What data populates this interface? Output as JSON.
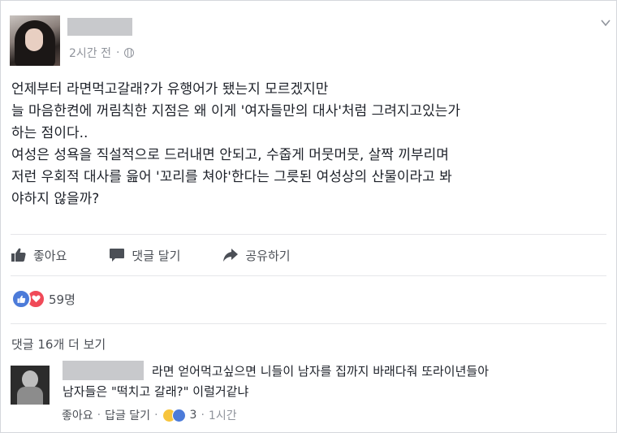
{
  "post": {
    "timestamp": "2시간 전",
    "body_lines": [
      "언제부터 라면먹고갈래?가 유행어가 됐는지 모르겠지만",
      "늘 마음한켠에 꺼림칙한 지점은 왜 이게 '여자들만의 대사'처럼 그려지고있는가",
      "하는 점이다..",
      "여성은 성욕을 직설적으로 드러내면 안되고, 수줍게 머뭇머뭇, 살짝 끼부리며",
      "저런 우회적 대사를 읊어 '꼬리를 쳐야'한다는 그릇된 여성상의 산물이라고 봐",
      "야하지 않을까?"
    ]
  },
  "actions": {
    "like": "좋아요",
    "comment": "댓글 달기",
    "share": "공유하기"
  },
  "reactions": {
    "count": "59명"
  },
  "comments": {
    "more_label": "댓글 16개 더 보기",
    "first": {
      "line1": "라면 얻어먹고싶으면 니들이 남자를 집까지 바래다줘 또라이년들아",
      "line2": "남자들은 \"떡치고 갈래?\" 이럴거같냐",
      "like_label": "좋아요",
      "reply_label": "답글 달기",
      "reaction_count": "3",
      "time": "1시간"
    }
  },
  "colors": {
    "like_blue": "#4c7bd9",
    "love_red": "#f04a58",
    "haha_yellow": "#f7c43c",
    "text": "#1d2129",
    "muted": "#90949c"
  },
  "icons": [
    "chevron-down-icon",
    "globe-icon",
    "thumbs-up-icon",
    "comment-icon",
    "share-icon",
    "heart-icon",
    "haha-icon"
  ]
}
